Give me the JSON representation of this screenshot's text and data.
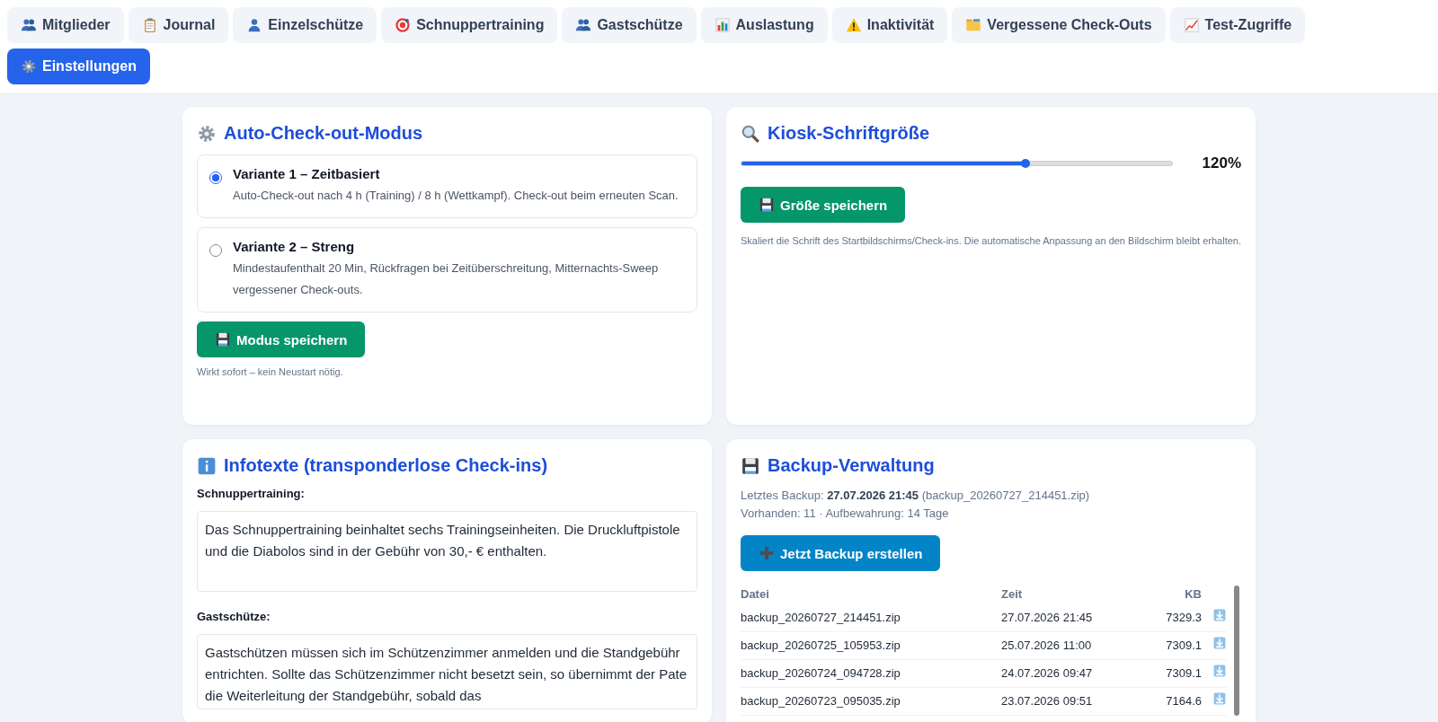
{
  "tabs": [
    {
      "label": "Mitglieder",
      "selected": false
    },
    {
      "label": "Journal",
      "selected": false
    },
    {
      "label": "Einzelschütze",
      "selected": false
    },
    {
      "label": "Schnuppertraining",
      "selected": false
    },
    {
      "label": "Gastschütze",
      "selected": false
    },
    {
      "label": "Auslastung",
      "selected": false
    },
    {
      "label": "Inaktivität",
      "selected": false
    },
    {
      "label": "Vergessene Check-Outs",
      "selected": false
    },
    {
      "label": "Test-Zugriffe",
      "selected": false
    },
    {
      "label": "Einstellungen",
      "selected": true
    }
  ],
  "auto_checkout": {
    "title": "Auto-Check-out-Modus",
    "options": [
      {
        "label": "Variante 1 – Zeitbasiert",
        "description": "Auto-Check-out nach 4 h (Training) / 8 h (Wettkampf). Check-out beim erneuten Scan.",
        "selected": true
      },
      {
        "label": "Variante 2 – Streng",
        "description": "Mindestaufenthalt 20 Min, Rückfragen bei Zeitüberschreitung, Mitternachts-Sweep vergessener Check-outs.",
        "selected": false
      }
    ],
    "button": "Modus speichern",
    "note": "Wirkt sofort – kein Neustart nötig."
  },
  "kiosk_font": {
    "title": "Kiosk-Schriftgröße",
    "level": 0.66,
    "reading": "120%",
    "button": "Größe speichern",
    "note": "Skaliert die Schrift des Startbildschirms/Check-ins. Die automatische Anpassung an den Bildschirm bleibt erhalten."
  },
  "infotexts": {
    "title": "Infotexte (transponderlose Check-ins)",
    "fields": [
      {
        "label": "Schnuppertraining:",
        "value": "Das Schnuppertraining beinhaltet sechs Trainingseinheiten. Die Druckluftpistole und die Diabolos sind in der Gebühr von 30,- € enthalten."
      },
      {
        "label": "Gastschütze:",
        "value": "Gastschützen müssen sich im Schützenzimmer anmelden und die Standgebühr entrichten. Sollte das Schützenzimmer nicht besetzt sein, so übernimmt der Pate die Weiterleitung der Standgebühr, sobald das"
      }
    ]
  },
  "backup": {
    "title": "Backup-Verwaltung",
    "last": "Letztes Backup: **27.07.2026 21:45** (backup_20260727_214451.zip)",
    "summary": "Vorhanden: 11 · Aufbewahrung: 14 Tage",
    "button": "Jetzt Backup erstellen",
    "columns": [
      "Datei",
      "Zeit",
      "KB"
    ],
    "rows": [
      [
        "backup_20260727_214451.zip",
        "27.07.2026 21:45",
        "7329.3"
      ],
      [
        "backup_20260725_105953.zip",
        "25.07.2026 11:00",
        "7309.1"
      ],
      [
        "backup_20260724_094728.zip",
        "24.07.2026 09:47",
        "7309.1"
      ],
      [
        "backup_20260723_095035.zip",
        "23.07.2026 09:51",
        "7164.6"
      ]
    ]
  }
}
